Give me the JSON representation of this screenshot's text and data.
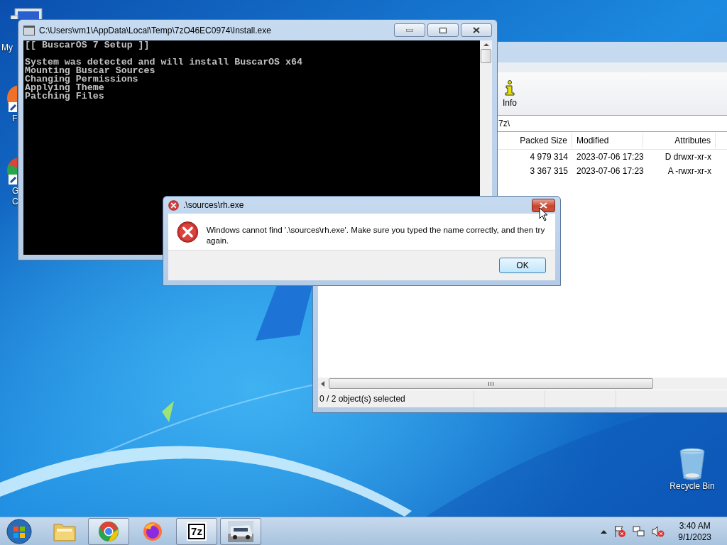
{
  "desktop_icons": [
    {
      "kind": "computer",
      "lines": [
        "My"
      ]
    },
    {
      "kind": "firefox",
      "lines": [
        "F"
      ]
    },
    {
      "kind": "chrome",
      "lines": [
        "G",
        "C"
      ]
    }
  ],
  "recycle_bin": {
    "label": "Recycle Bin"
  },
  "archive_window": {
    "toolbar": [
      {
        "label": "Info"
      }
    ],
    "path": "7z\\",
    "columns": [
      "Packed Size",
      "Modified",
      "Attributes"
    ],
    "rows": [
      [
        "4 979 314",
        "2023-07-06 17:23",
        "D drwxr-xr-x"
      ],
      [
        "3 367 315",
        "2023-07-06 17:23",
        "A -rwxr-xr-x"
      ]
    ],
    "status_bar": "0 / 2 object(s) selected"
  },
  "console_window": {
    "title": "C:\\Users\\vm1\\AppData\\Local\\Temp\\7zO46EC0974\\Install.exe",
    "blocks": [
      [
        "[[ BuscarOS 7 Setup ]]"
      ],
      [
        "System was detected and will install BuscarOS x64",
        "Mounting Buscar Sources",
        "Changing Permissions",
        "Applying Theme",
        "Patching Files"
      ]
    ]
  },
  "error_dialog": {
    "title": ".\\sources\\rh.exe",
    "message": "Windows cannot find '.\\sources\\rh.exe'. Make sure you typed the name correctly, and then try again.",
    "button": "OK"
  },
  "taskbar": {
    "apps": [
      {
        "kind": "explorer",
        "running": false
      },
      {
        "kind": "chrome",
        "running": true
      },
      {
        "kind": "firefox",
        "running": false
      },
      {
        "kind": "sevenzip",
        "running": true,
        "label": "7z"
      },
      {
        "kind": "thumbnail",
        "running": true
      }
    ],
    "clock": {
      "time": "3:40 AM",
      "date": "9/1/2023"
    }
  }
}
